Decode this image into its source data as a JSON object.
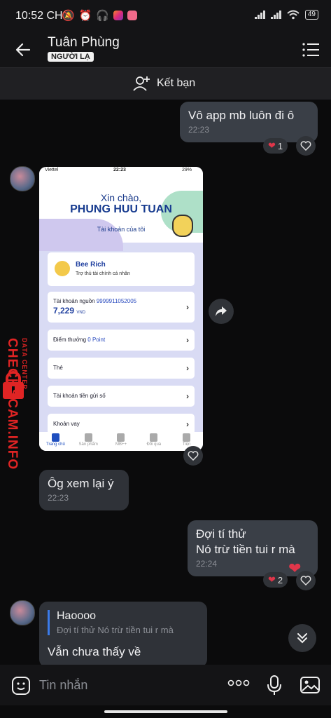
{
  "status_bar": {
    "time": "10:52 CH",
    "battery": "49"
  },
  "header": {
    "name": "Tuân Phùng",
    "badge": "NGƯỜI LẠ"
  },
  "friend_bar": {
    "label": "Kết bạn"
  },
  "messages": [
    {
      "text": "Vô app mb luôn đi ô",
      "time": "22:23",
      "reaction_count": "1"
    },
    {
      "text": "Ôg xem lại ý",
      "time": "22:23"
    },
    {
      "line1": "Đợi tí thử",
      "line2": "Nó trừ tiền tui r mà",
      "time": "22:24",
      "reaction_count": "2"
    }
  ],
  "reply": {
    "quote_title": "Haoooo",
    "quote_text": "Đợi tí thử Nó trừ tiền tui r mà",
    "text": "Vẫn chưa thấy về"
  },
  "shared_screenshot": {
    "carrier": "Viettel",
    "time": "22:23",
    "battery": "29%",
    "greeting": "Xin chào,",
    "name": "PHUNG HUU TUAN",
    "account_label": "Tài khoản của tôi",
    "bee_title": "Bee Rich",
    "bee_sub": "Trợ thủ tài chính cá nhân",
    "source_account_label": "Tài khoản nguồn",
    "source_account_number": "9999911052005",
    "balance": "7,229",
    "currency": "VND",
    "points_label": "Điểm thưởng",
    "points_value": "0 Point",
    "card_label": "Thẻ",
    "savings_label": "Tài khoản tiền gửi số",
    "loan_label": "Khoản vay",
    "nav": [
      "Trang chủ",
      "Sản phẩm",
      "MB++",
      "Đổi quà",
      "Tiện"
    ]
  },
  "watermark": {
    "main": "CHECKSCAM.INFO",
    "sub": "DATA CENTER"
  },
  "input": {
    "placeholder": "Tin nhắn"
  },
  "colors": {
    "accent_blue": "#3b7bea",
    "watermark_red": "#e02424",
    "reaction_heart": "#e0364a"
  }
}
